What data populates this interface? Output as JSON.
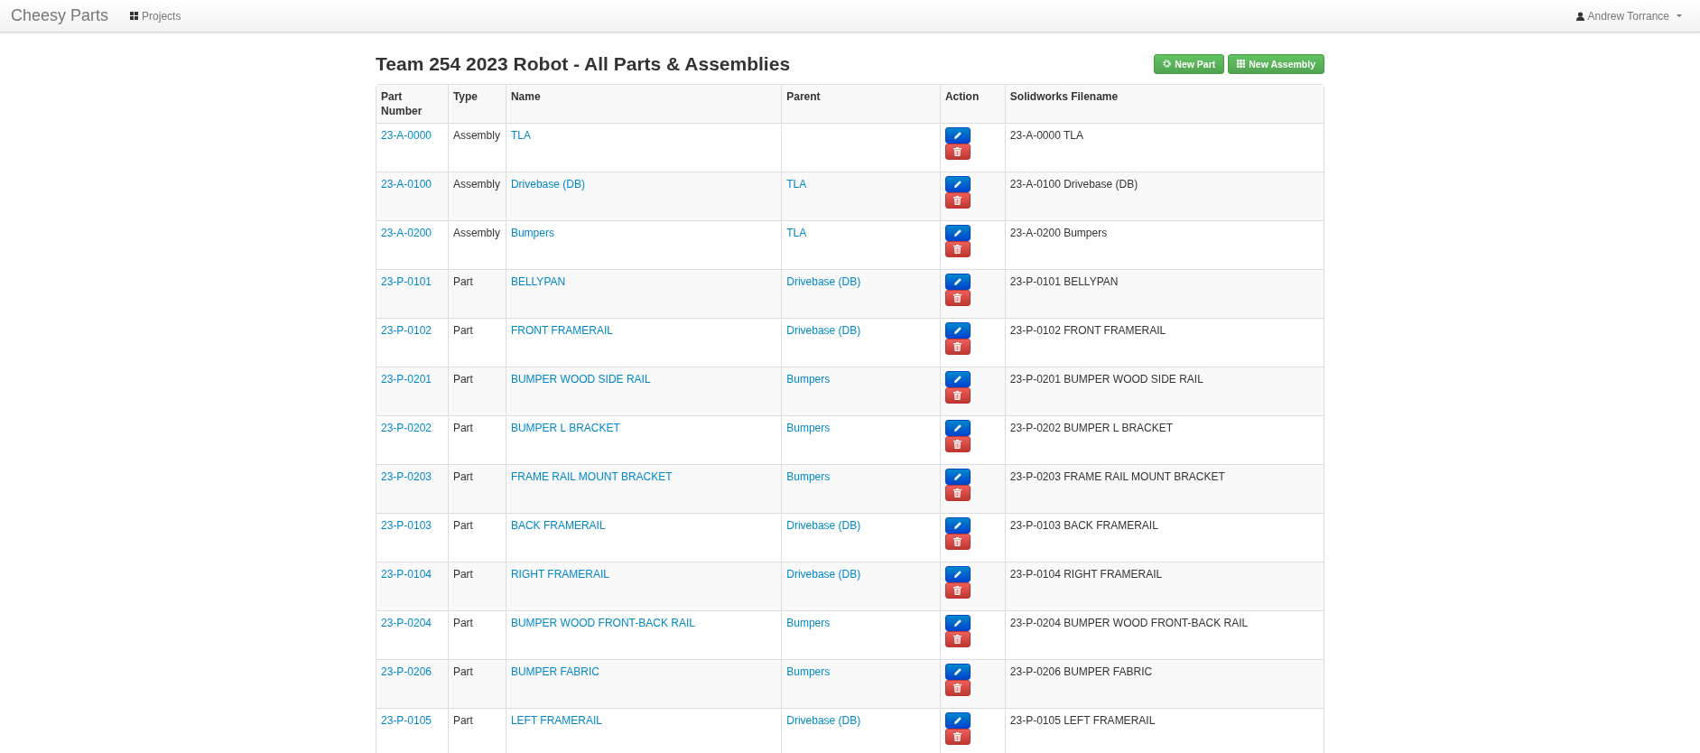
{
  "navbar": {
    "brand": "Cheesy Parts",
    "links": [
      {
        "label": "Projects"
      }
    ],
    "user": "Andrew Torrance"
  },
  "title": "Team 254 2023 Robot - All Parts & Assemblies",
  "buttons": [
    {
      "label": "New Part",
      "kind": "part"
    },
    {
      "label": "New Assembly",
      "kind": "assembly"
    }
  ],
  "table": {
    "columns": [
      "Part Number",
      "Type",
      "Name",
      "Parent",
      "Action",
      "Solidworks Filename"
    ],
    "rows": [
      {
        "part_number": "23-A-0000",
        "type": "Assembly",
        "name": "TLA",
        "parent": "",
        "filename": "23-A-0000 TLA"
      },
      {
        "part_number": "23-A-0100",
        "type": "Assembly",
        "name": "Drivebase (DB)",
        "parent": "TLA",
        "filename": "23-A-0100 Drivebase (DB)"
      },
      {
        "part_number": "23-A-0200",
        "type": "Assembly",
        "name": "Bumpers",
        "parent": "TLA",
        "filename": "23-A-0200 Bumpers"
      },
      {
        "part_number": "23-P-0101",
        "type": "Part",
        "name": "BELLYPAN",
        "parent": "Drivebase (DB)",
        "filename": "23-P-0101 BELLYPAN"
      },
      {
        "part_number": "23-P-0102",
        "type": "Part",
        "name": "FRONT FRAMERAIL",
        "parent": "Drivebase (DB)",
        "filename": "23-P-0102 FRONT FRAMERAIL"
      },
      {
        "part_number": "23-P-0201",
        "type": "Part",
        "name": "BUMPER WOOD SIDE RAIL",
        "parent": "Bumpers",
        "filename": "23-P-0201 BUMPER WOOD SIDE RAIL"
      },
      {
        "part_number": "23-P-0202",
        "type": "Part",
        "name": "BUMPER L BRACKET",
        "parent": "Bumpers",
        "filename": "23-P-0202 BUMPER L BRACKET"
      },
      {
        "part_number": "23-P-0203",
        "type": "Part",
        "name": "FRAME RAIL MOUNT BRACKET",
        "parent": "Bumpers",
        "filename": "23-P-0203 FRAME RAIL MOUNT BRACKET"
      },
      {
        "part_number": "23-P-0103",
        "type": "Part",
        "name": "BACK FRAMERAIL",
        "parent": "Drivebase (DB)",
        "filename": "23-P-0103 BACK FRAMERAIL"
      },
      {
        "part_number": "23-P-0104",
        "type": "Part",
        "name": "RIGHT FRAMERAIL",
        "parent": "Drivebase (DB)",
        "filename": "23-P-0104 RIGHT FRAMERAIL"
      },
      {
        "part_number": "23-P-0204",
        "type": "Part",
        "name": "BUMPER WOOD FRONT-BACK RAIL",
        "parent": "Bumpers",
        "filename": "23-P-0204 BUMPER WOOD FRONT-BACK RAIL"
      },
      {
        "part_number": "23-P-0206",
        "type": "Part",
        "name": "BUMPER FABRIC",
        "parent": "Bumpers",
        "filename": "23-P-0206 BUMPER FABRIC"
      },
      {
        "part_number": "23-P-0105",
        "type": "Part",
        "name": "LEFT FRAMERAIL",
        "parent": "Drivebase (DB)",
        "filename": "23-P-0105 LEFT FRAMERAIL"
      }
    ]
  }
}
